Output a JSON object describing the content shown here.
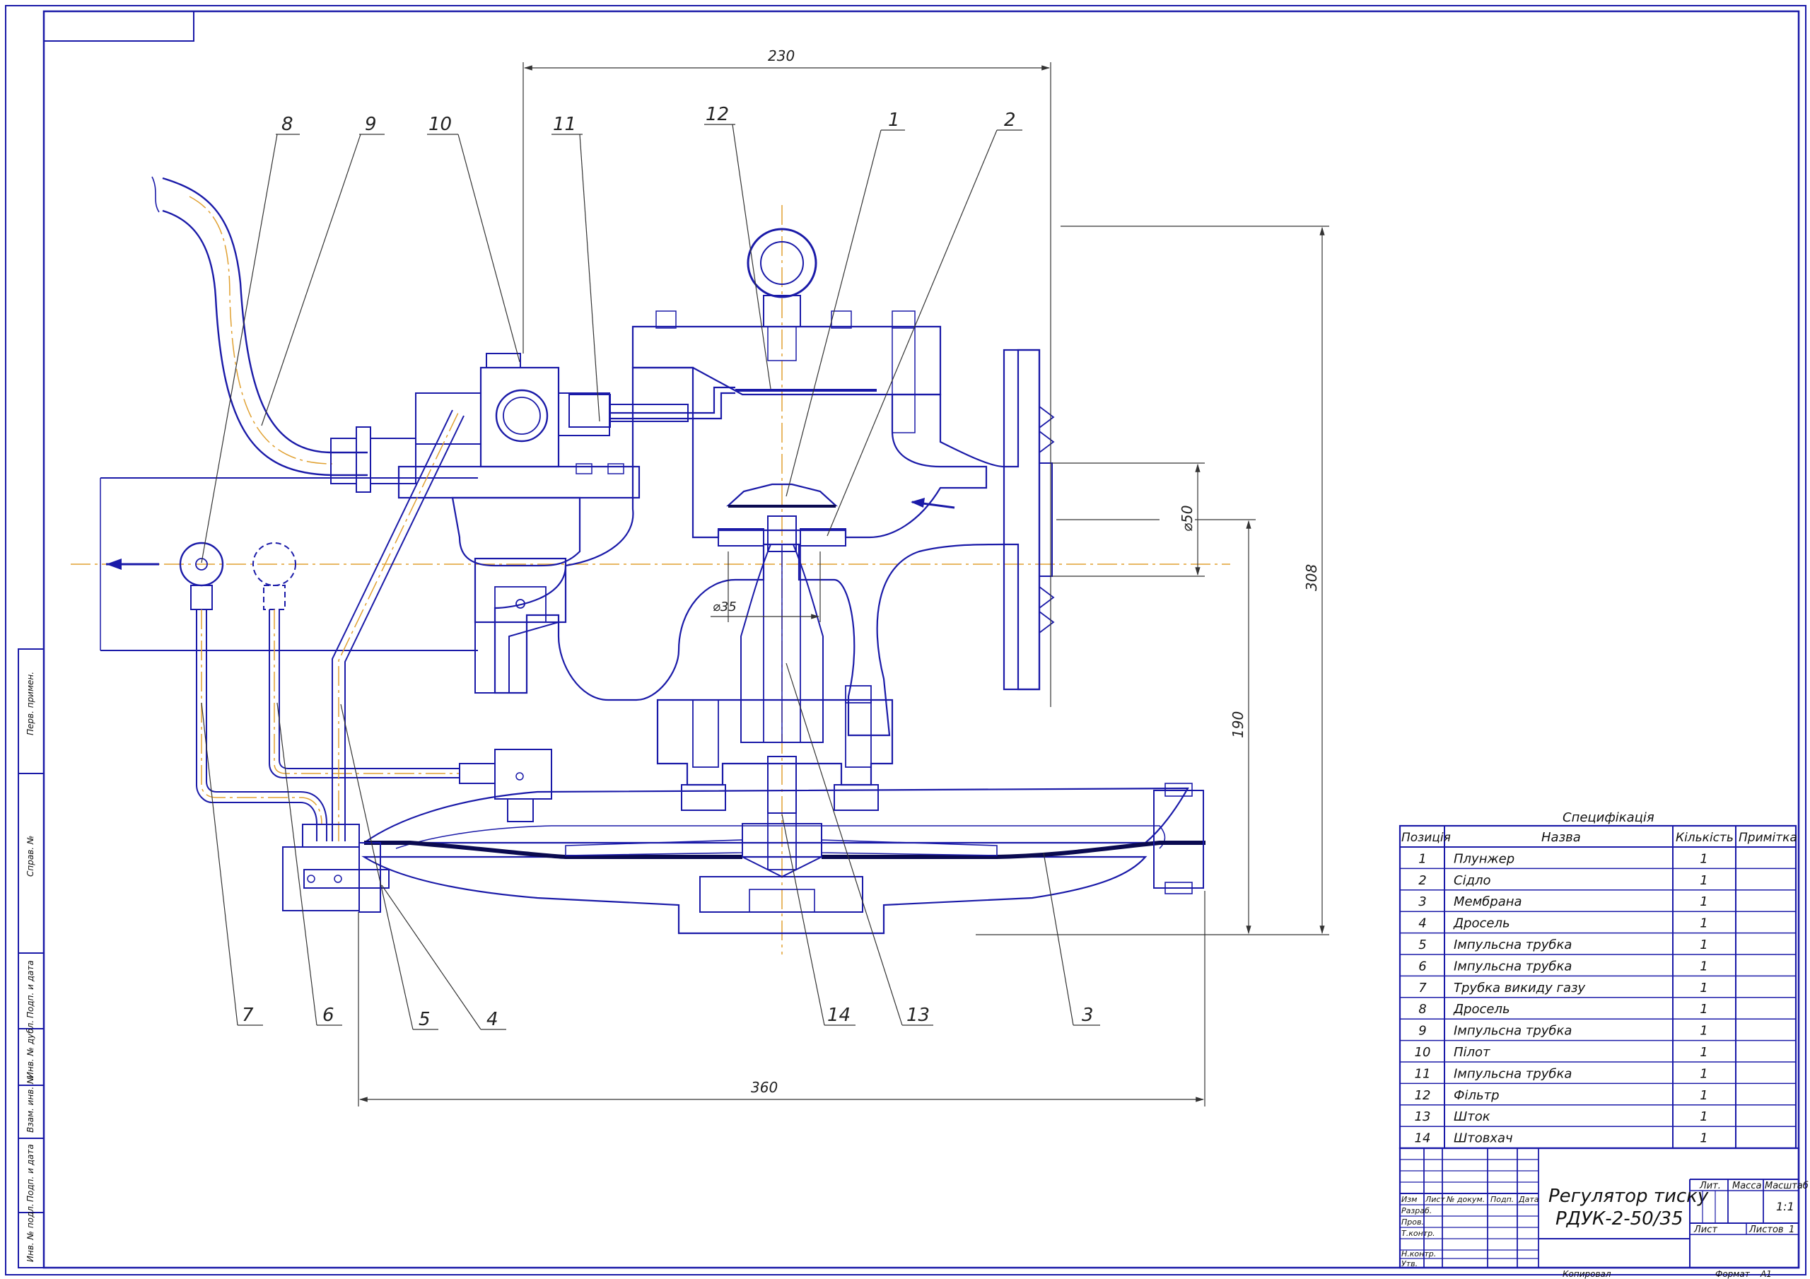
{
  "dimensions": {
    "top_width": "230",
    "total_height": "308",
    "lower_height": "190",
    "bottom_width": "360",
    "outlet_diameter": "⌀50",
    "seat_diameter": "⌀35"
  },
  "callouts": [
    "8",
    "9",
    "10",
    "11",
    "12",
    "1",
    "2",
    "7",
    "6",
    "5",
    "4",
    "14",
    "13",
    "3"
  ],
  "spec": {
    "title": "Специфікація",
    "headers": [
      "Позиція",
      "Назва",
      "Кількість",
      "Примітка"
    ],
    "rows": [
      {
        "pos": "1",
        "name": "Плунжер",
        "qty": "1"
      },
      {
        "pos": "2",
        "name": "Сідло",
        "qty": "1"
      },
      {
        "pos": "3",
        "name": "Мембрана",
        "qty": "1"
      },
      {
        "pos": "4",
        "name": "Дросель",
        "qty": "1"
      },
      {
        "pos": "5",
        "name": "Імпульсна трубка",
        "qty": "1"
      },
      {
        "pos": "6",
        "name": "Імпульсна трубка",
        "qty": "1"
      },
      {
        "pos": "7",
        "name": "Трубка викиду газу",
        "qty": "1"
      },
      {
        "pos": "8",
        "name": "Дросель",
        "qty": "1"
      },
      {
        "pos": "9",
        "name": "Імпульсна трубка",
        "qty": "1"
      },
      {
        "pos": "10",
        "name": "Пілот",
        "qty": "1"
      },
      {
        "pos": "11",
        "name": "Імпульсна трубка",
        "qty": "1"
      },
      {
        "pos": "12",
        "name": "Фільтр",
        "qty": "1"
      },
      {
        "pos": "13",
        "name": "Шток",
        "qty": "1"
      },
      {
        "pos": "14",
        "name": "Штовхач",
        "qty": "1"
      }
    ]
  },
  "title_block": {
    "title_line1": "Регулятор тиску",
    "title_line2": "РДУК-2-50/35",
    "col_izm": "Изм",
    "col_list": "Лист",
    "col_docnum": "№ докум.",
    "col_podp": "Подп.",
    "col_data": "Дата",
    "row_razrab": "Разраб.",
    "row_prov": "Пров.",
    "row_tkontr": "Т.контр.",
    "row_nkontr": "Н.контр.",
    "row_utv": "Утв.",
    "lit": "Лит.",
    "massa": "Масса",
    "masshtab": "Масштаб",
    "scale_value": "1:1",
    "list": "Лист",
    "listov": "Листов",
    "listov_value": "1",
    "kopiroval": "Копировал",
    "format": "Формат",
    "format_value": "А1"
  },
  "side_stamps": [
    "Перв. примен.",
    "Справ. №",
    "Подп. и дата",
    "Инв. № дубл.",
    "Взам. инв. №",
    "Подп. и дата",
    "Инв. № подл."
  ],
  "colors": {
    "outline": "#1a1aa8",
    "axis": "#e0a030",
    "hatch": "#555555",
    "membrane": "#0a0a50"
  }
}
